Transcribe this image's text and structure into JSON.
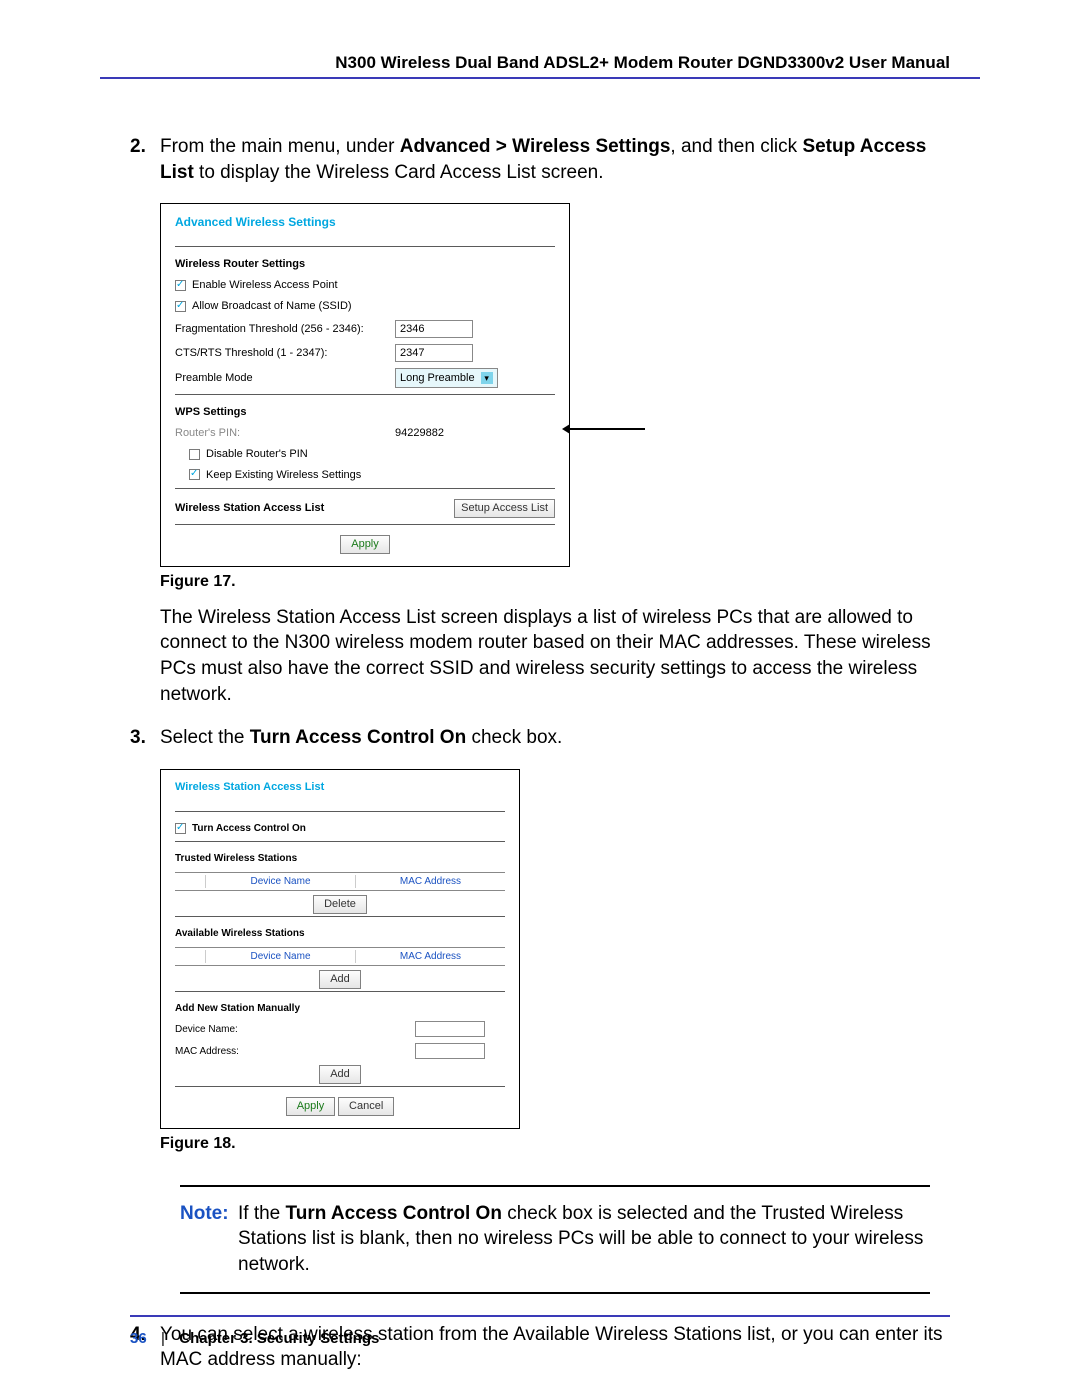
{
  "header": {
    "title": "N300 Wireless Dual Band ADSL2+ Modem Router DGND3300v2 User Manual"
  },
  "steps": {
    "s2_num": "2.",
    "s2_a": "From the main menu, under ",
    "s2_b": "Advanced > Wireless Settings",
    "s2_c": ", and then click ",
    "s2_d": "Setup Access List",
    "s2_e": " to display the Wireless Card Access List screen.",
    "fig17": "Figure 17.",
    "para17": "The Wireless Station Access List screen displays a list of wireless PCs that are allowed to connect to the N300 wireless modem router based on their MAC addresses. These wireless PCs must also have the correct SSID and wireless security settings to access the wireless network.",
    "s3_num": "3.",
    "s3_a": "Select the ",
    "s3_b": "Turn Access Control On",
    "s3_c": " check box.",
    "fig18": "Figure 18.",
    "note_label": "Note:",
    "note_a": "If the ",
    "note_b": "Turn Access Control On",
    "note_c": " check box is selected and the Trusted Wireless Stations list is blank, then no wireless PCs will be able to connect to your wireless network.",
    "s4_num": "4.",
    "s4_a": "You can select a wireless station from the Available Wireless Stations list, or you can enter its MAC address manually:"
  },
  "shot1": {
    "title": "Advanced Wireless Settings",
    "sec1": "Wireless Router Settings",
    "enable_ap": "Enable Wireless Access Point",
    "allow_ssid": "Allow Broadcast of Name (SSID)",
    "frag_lbl": "Fragmentation Threshold (256 - 2346):",
    "frag_val": "2346",
    "cts_lbl": "CTS/RTS Threshold (1 - 2347):",
    "cts_val": "2347",
    "preamble_lbl": "Preamble Mode",
    "preamble_val": "Long Preamble",
    "sec2": "WPS Settings",
    "router_pin_lbl": "Router's PIN:",
    "router_pin_val": "94229882",
    "disable_pin": "Disable Router's PIN",
    "keep_existing": "Keep Existing Wireless Settings",
    "sec3": "Wireless Station Access List",
    "setup_btn": "Setup Access List",
    "apply": "Apply"
  },
  "shot2": {
    "title": "Wireless Station Access List",
    "turn_on": "Turn Access Control On",
    "trusted": "Trusted Wireless Stations",
    "device_name": "Device Name",
    "mac_addr": "MAC Address",
    "delete": "Delete",
    "available": "Available Wireless Stations",
    "addnew": "Add New Station Manually",
    "devname_lbl": "Device Name:",
    "mac_lbl": "MAC Address:",
    "add": "Add",
    "apply": "Apply",
    "cancel": "Cancel"
  },
  "footer": {
    "page": "36",
    "chapter": "Chapter 3.  Security Settings"
  }
}
